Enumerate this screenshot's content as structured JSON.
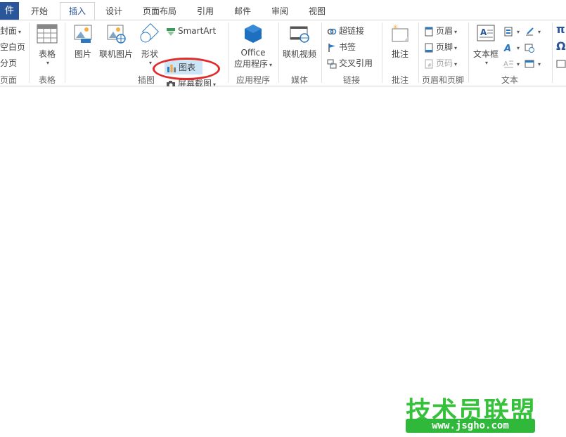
{
  "tabs": {
    "file": "件",
    "home": "开始",
    "insert": "插入",
    "design": "设计",
    "layout": "页面布局",
    "references": "引用",
    "mailings": "邮件",
    "review": "审阅",
    "view": "视图"
  },
  "pages": {
    "cover": "封面",
    "blank": "空白页",
    "break": "分页",
    "group": "页面"
  },
  "table": {
    "button": "表格",
    "group": "表格"
  },
  "illustrations": {
    "picture": "图片",
    "online_picture": "联机图片",
    "shapes": "形状",
    "smartart": "SmartArt",
    "chart": "图表",
    "screenshot": "屏幕截图",
    "group": "插图"
  },
  "apps": {
    "office_line1": "Office",
    "office_line2": "应用程序",
    "group": "应用程序"
  },
  "media": {
    "online_video": "联机视频",
    "group": "媒体"
  },
  "links": {
    "hyperlink": "超链接",
    "bookmark": "书签",
    "cross_reference": "交叉引用",
    "group": "链接"
  },
  "comments": {
    "comment": "批注",
    "group": "批注"
  },
  "header_footer": {
    "header": "页眉",
    "footer": "页脚",
    "page_number": "页码",
    "group": "页眉和页脚"
  },
  "text": {
    "textbox": "文本框",
    "group": "文本"
  },
  "symbols": {
    "equation": "π",
    "symbol": "Ω"
  },
  "watermark": {
    "text": "技术员联盟",
    "url": "www.jsgho.com"
  },
  "colors": {
    "accent": "#2b579a",
    "highlight": "#cde6f7",
    "annotation": "#e32a2a",
    "watermark": "#36c13b"
  }
}
